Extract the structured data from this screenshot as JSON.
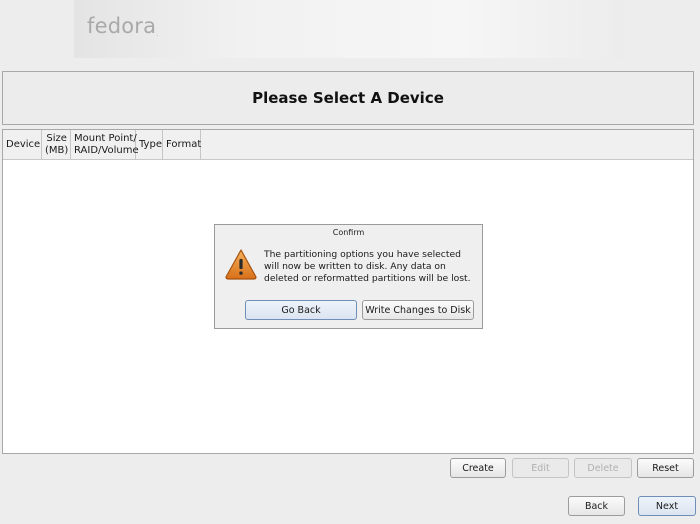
{
  "brand": {
    "logo_text": "fedora",
    "logo_mark": "."
  },
  "page": {
    "title": "Please Select A Device"
  },
  "table": {
    "columns": [
      {
        "line1": "Device",
        "line2": ""
      },
      {
        "line1": "Size",
        "line2": "(MB)"
      },
      {
        "line1": "Mount Point/",
        "line2": "RAID/Volume"
      },
      {
        "line1": "Type",
        "line2": ""
      },
      {
        "line1": "Format",
        "line2": ""
      }
    ]
  },
  "dialog": {
    "title": "Confirm",
    "icon": "warning-icon",
    "message": "The partitioning options you have selected will now be written to disk.  Any data on deleted or reformatted partitions will be lost.",
    "go_back_label": "Go Back",
    "write_label": "Write Changes to Disk"
  },
  "actions": {
    "create": "Create",
    "edit": "Edit",
    "delete": "Delete",
    "reset": "Reset"
  },
  "nav": {
    "back": "Back",
    "next": "Next"
  },
  "colors": {
    "warning": "#e8862a",
    "focus_border": "#6f8fb8"
  }
}
